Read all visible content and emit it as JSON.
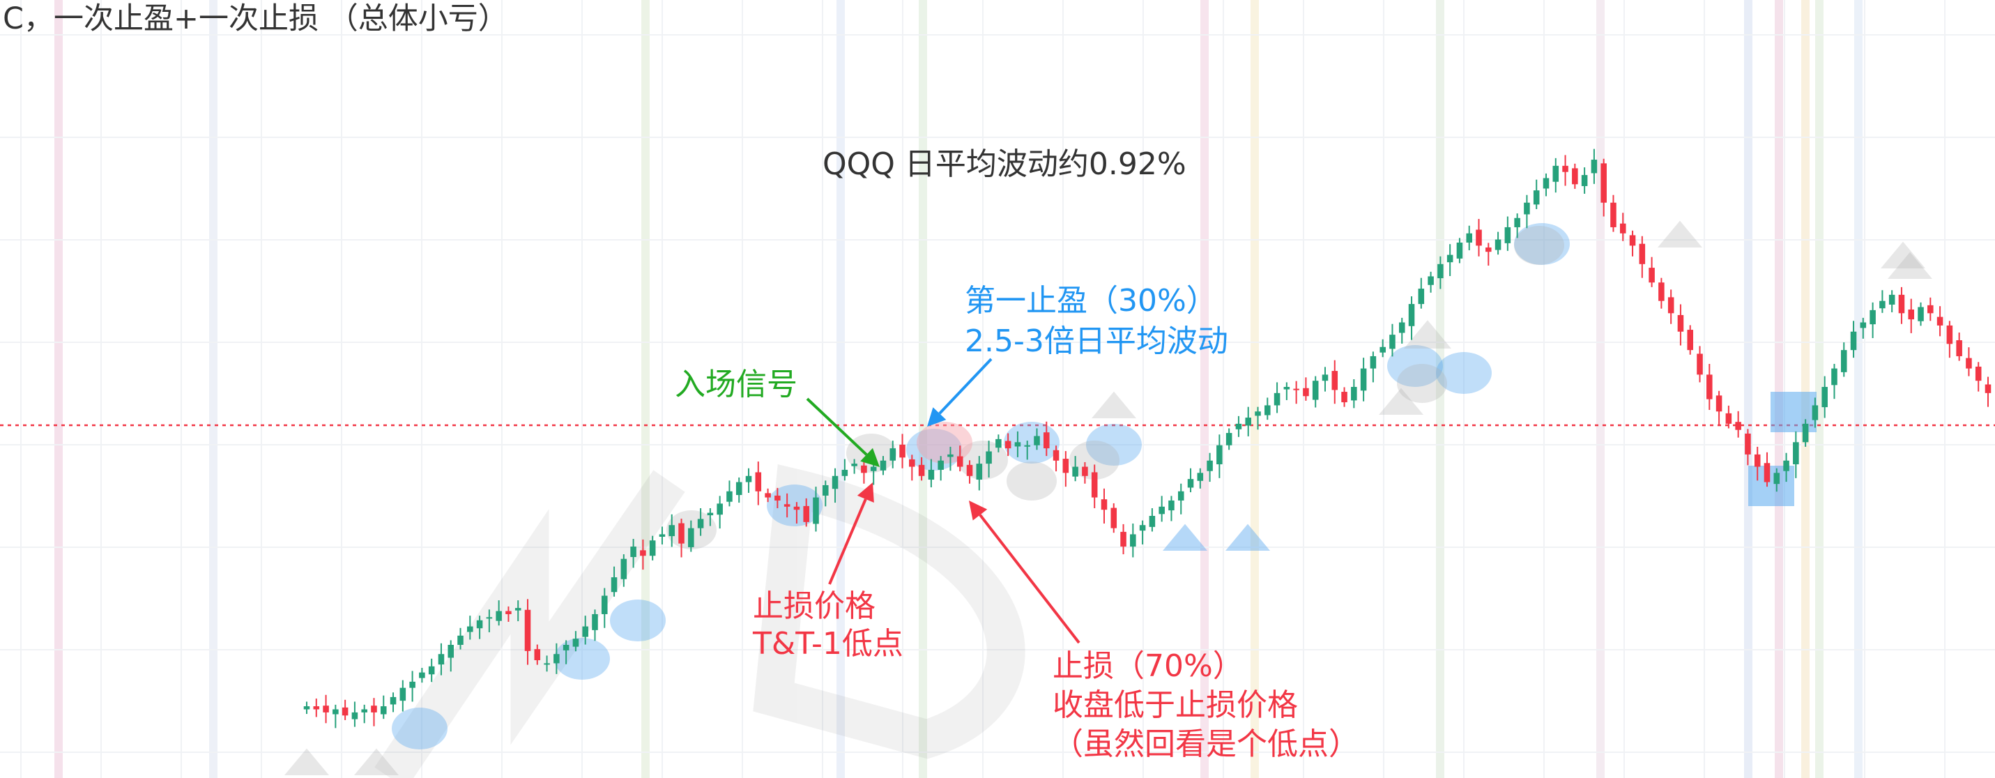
{
  "title": "C，一次止盈+一次止损 （总体小亏）",
  "subtitle": "QQQ 日平均波动约0.92%",
  "colors": {
    "up": "#26a17b",
    "down": "#f23645",
    "blue_annotation": "#2196f3",
    "green_annotation": "#22aa22",
    "red_annotation": "#f23645",
    "dotted_line": "#f23645",
    "marker_fill": "#5aa9ef",
    "grey_marker": "#b0b0b0"
  },
  "annotations": {
    "take_profit_line1": "第一止盈（30%）",
    "take_profit_line2": "2.5-3倍日平均波动",
    "entry_signal": "入场信号",
    "stop_price_line1": "止损价格",
    "stop_price_line2": "T&T-1低点",
    "stop_loss_line1": "止损（70%）",
    "stop_loss_line2": "收盘低于止损价格",
    "stop_loss_line3": "（虽然回看是个低点）"
  },
  "chart_data": {
    "type": "candlestick",
    "title": "C，一次止盈+一次止损 （总体小亏）",
    "subtitle": "QQQ 日平均波动约0.92%",
    "xlabel": "",
    "ylabel": "",
    "grid": true,
    "axes_visible": false,
    "reference_line": {
      "style": "dotted",
      "color": "#f23645"
    },
    "series": [
      {
        "name": "QQQ",
        "values": [
          82,
          81,
          80,
          81,
          79,
          80,
          81,
          80,
          82,
          85,
          88,
          90,
          93,
          95,
          99,
          102,
          105,
          108,
          110,
          111,
          113,
          112,
          114,
          100,
          97,
          96,
          99,
          102,
          104,
          108,
          112,
          118,
          124,
          130,
          134,
          131,
          136,
          138,
          141,
          135,
          140,
          143,
          145,
          148,
          152,
          155,
          157,
          152,
          150,
          149,
          147,
          146,
          142,
          150,
          154,
          157,
          159,
          161,
          158,
          160,
          162,
          166,
          163,
          160,
          157,
          159,
          162,
          164,
          160,
          157,
          161,
          165,
          169,
          166,
          168,
          167,
          170,
          166,
          162,
          158,
          160,
          157,
          150,
          146,
          140,
          134,
          138,
          141,
          144,
          147,
          149,
          152,
          156,
          158,
          162,
          167,
          171,
          174,
          176,
          178,
          180,
          184,
          186,
          185,
          183,
          188,
          190,
          185,
          181,
          186,
          192,
          196,
          199,
          203,
          207,
          213,
          218,
          222,
          226,
          229,
          233,
          236,
          232,
          230,
          234,
          238,
          241,
          246,
          250,
          254,
          258,
          256,
          252,
          255,
          260,
          246,
          238,
          236,
          232,
          226,
          220,
          214,
          210,
          204,
          198,
          190,
          182,
          178,
          174,
          172,
          164,
          160,
          155,
          158,
          162,
          168,
          174,
          180,
          186,
          192,
          198,
          204,
          207,
          211,
          214,
          216,
          210,
          208,
          212,
          210,
          206,
          200,
          196,
          192,
          188,
          184
        ]
      }
    ]
  }
}
